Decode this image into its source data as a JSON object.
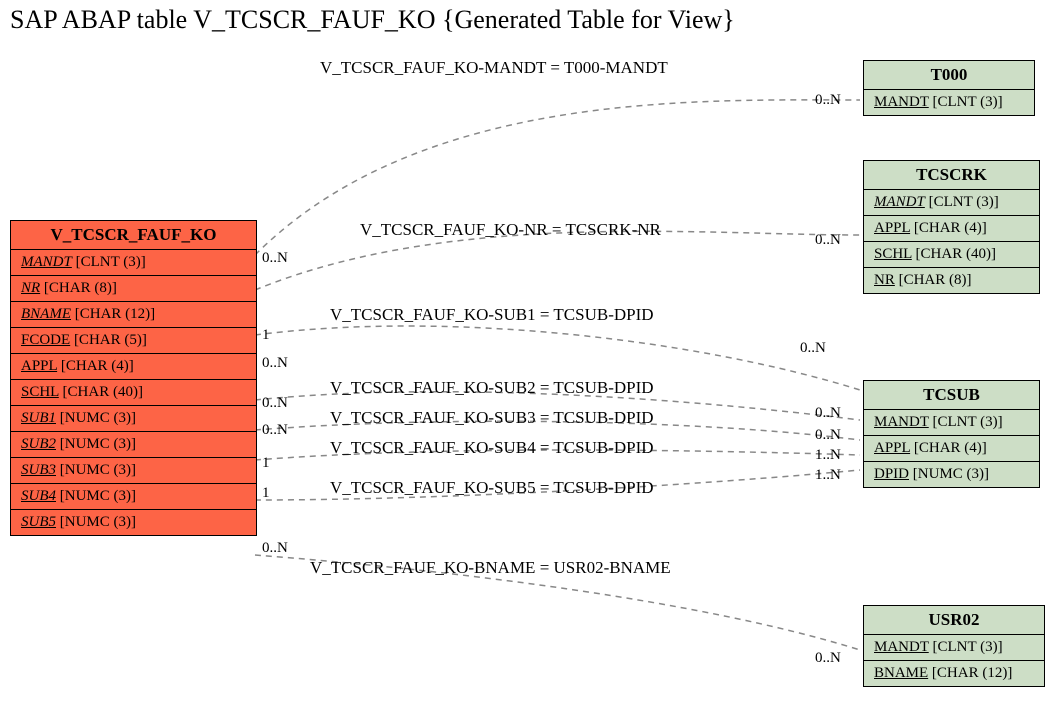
{
  "title": "SAP ABAP table V_TCSCR_FAUF_KO {Generated Table for View}",
  "main": {
    "name": "V_TCSCR_FAUF_KO",
    "rows": [
      {
        "field": "MANDT",
        "type": "[CLNT (3)]",
        "italic": true
      },
      {
        "field": "NR",
        "type": "[CHAR (8)]",
        "italic": true
      },
      {
        "field": "BNAME",
        "type": "[CHAR (12)]",
        "italic": true
      },
      {
        "field": "FCODE",
        "type": "[CHAR (5)]",
        "italic": false
      },
      {
        "field": "APPL",
        "type": "[CHAR (4)]",
        "italic": false
      },
      {
        "field": "SCHL",
        "type": "[CHAR (40)]",
        "italic": false
      },
      {
        "field": "SUB1",
        "type": "[NUMC (3)]",
        "italic": true
      },
      {
        "field": "SUB2",
        "type": "[NUMC (3)]",
        "italic": true
      },
      {
        "field": "SUB3",
        "type": "[NUMC (3)]",
        "italic": true
      },
      {
        "field": "SUB4",
        "type": "[NUMC (3)]",
        "italic": true
      },
      {
        "field": "SUB5",
        "type": "[NUMC (3)]",
        "italic": true
      }
    ]
  },
  "t000": {
    "name": "T000",
    "rows": [
      {
        "field": "MANDT",
        "type": "[CLNT (3)]",
        "italic": false
      }
    ]
  },
  "tcscrk": {
    "name": "TCSCRK",
    "rows": [
      {
        "field": "MANDT",
        "type": "[CLNT (3)]",
        "italic": true
      },
      {
        "field": "APPL",
        "type": "[CHAR (4)]",
        "italic": false
      },
      {
        "field": "SCHL",
        "type": "[CHAR (40)]",
        "italic": false
      },
      {
        "field": "NR",
        "type": "[CHAR (8)]",
        "italic": false
      }
    ]
  },
  "tcsub": {
    "name": "TCSUB",
    "rows": [
      {
        "field": "MANDT",
        "type": "[CLNT (3)]",
        "italic": false
      },
      {
        "field": "APPL",
        "type": "[CHAR (4)]",
        "italic": false
      },
      {
        "field": "DPID",
        "type": "[NUMC (3)]",
        "italic": false
      }
    ]
  },
  "usr02": {
    "name": "USR02",
    "rows": [
      {
        "field": "MANDT",
        "type": "[CLNT (3)]",
        "italic": false
      },
      {
        "field": "BNAME",
        "type": "[CHAR (12)]",
        "italic": false
      }
    ]
  },
  "rels": [
    {
      "label": "V_TCSCR_FAUF_KO-MANDT = T000-MANDT",
      "lcard": "0..N",
      "rcard": "0..N"
    },
    {
      "label": "V_TCSCR_FAUF_KO-NR = TCSCRK-NR",
      "lcard": "",
      "rcard": "0..N"
    },
    {
      "label": "V_TCSCR_FAUF_KO-SUB1 = TCSUB-DPID",
      "lcard": "1",
      "rcard": "0..N"
    },
    {
      "label": "V_TCSCR_FAUF_KO-SUB2 = TCSUB-DPID",
      "lcard": "0..N",
      "rcard": "0..N"
    },
    {
      "label": "V_TCSCR_FAUF_KO-SUB3 = TCSUB-DPID",
      "lcard": "0..N",
      "rcard": "0..N"
    },
    {
      "label": "V_TCSCR_FAUF_KO-SUB4 = TCSUB-DPID",
      "lcard": "0..N",
      "rcard": "1..N"
    },
    {
      "label": "V_TCSCR_FAUF_KO-SUB5 = TCSUB-DPID",
      "lcard": "1",
      "rcard": "1..N"
    },
    {
      "label": "V_TCSCR_FAUF_KO-BNAME = USR02-BNAME",
      "lcard": "1",
      "rcard": "0..N"
    }
  ],
  "lcard_top": "0..N"
}
